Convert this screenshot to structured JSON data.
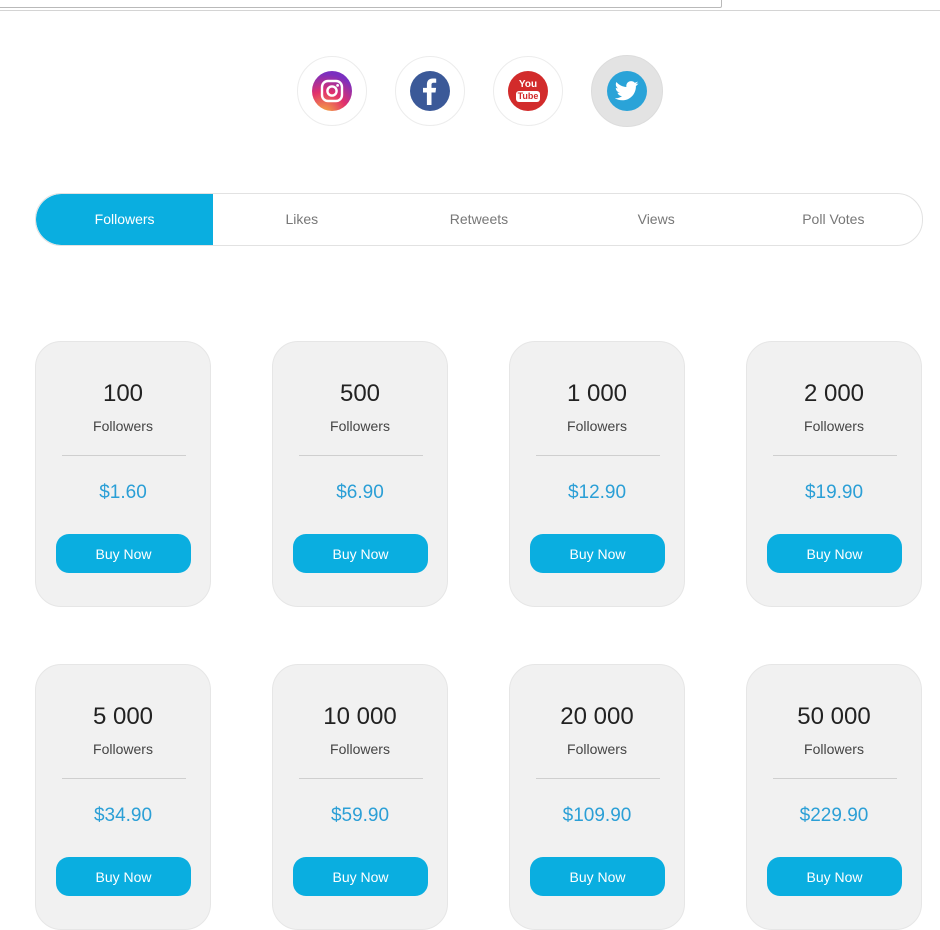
{
  "networks": [
    {
      "name": "Instagram",
      "icon": "instagram-icon",
      "color": "#7a2fc0",
      "active": false
    },
    {
      "name": "Facebook",
      "icon": "facebook-icon",
      "color": "#3b5998",
      "active": false
    },
    {
      "name": "YouTube",
      "icon": "youtube-icon",
      "color": "#d22b2b",
      "active": false
    },
    {
      "name": "Twitter",
      "icon": "twitter-icon",
      "color": "#2aa3d8",
      "active": true
    }
  ],
  "youtube_logo": {
    "top": "You",
    "bottom": "Tube"
  },
  "tabs": [
    {
      "label": "Followers",
      "active": true
    },
    {
      "label": "Likes",
      "active": false
    },
    {
      "label": "Retweets",
      "active": false
    },
    {
      "label": "Views",
      "active": false
    },
    {
      "label": "Poll Votes",
      "active": false
    }
  ],
  "packages": [
    {
      "quantity": "100",
      "unit": "Followers",
      "price": "$1.60",
      "button": "Buy Now"
    },
    {
      "quantity": "500",
      "unit": "Followers",
      "price": "$6.90",
      "button": "Buy Now"
    },
    {
      "quantity": "1 000",
      "unit": "Followers",
      "price": "$12.90",
      "button": "Buy Now"
    },
    {
      "quantity": "2 000",
      "unit": "Followers",
      "price": "$19.90",
      "button": "Buy Now"
    },
    {
      "quantity": "5 000",
      "unit": "Followers",
      "price": "$34.90",
      "button": "Buy Now"
    },
    {
      "quantity": "10 000",
      "unit": "Followers",
      "price": "$59.90",
      "button": "Buy Now"
    },
    {
      "quantity": "20 000",
      "unit": "Followers",
      "price": "$109.90",
      "button": "Buy Now"
    },
    {
      "quantity": "50 000",
      "unit": "Followers",
      "price": "$229.90",
      "button": "Buy Now"
    }
  ],
  "colors": {
    "accent": "#0aaee0",
    "price": "#2b9fd6",
    "card_bg": "#f1f1f1"
  }
}
